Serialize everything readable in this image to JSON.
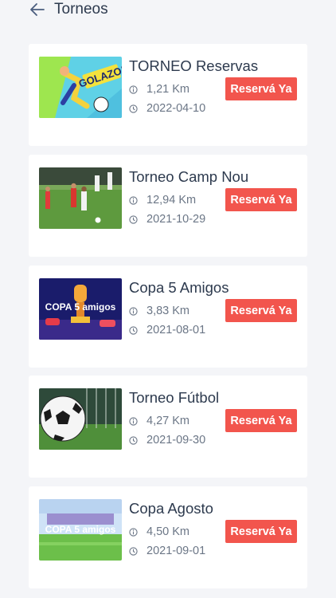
{
  "header": {
    "title": "Torneos",
    "back_icon": "arrow-left-icon"
  },
  "colors": {
    "accent": "#f2554d",
    "text_primary": "#2d3a4e",
    "text_secondary": "#6b7686",
    "background": "#f4f5f8",
    "card": "#ffffff"
  },
  "tournaments": [
    {
      "name": "TORNEO Reservas",
      "distance": "1,21 Km",
      "date": "2022-04-10",
      "button": "Reservá Ya",
      "image_text": "GOLAZO!"
    },
    {
      "name": "Torneo Camp Nou",
      "distance": "12,94 Km",
      "date": "2021-10-29",
      "button": "Reservá Ya",
      "image_text": ""
    },
    {
      "name": "Copa 5 Amigos",
      "distance": "3,83 Km",
      "date": "2021-08-01",
      "button": "Reservá Ya",
      "image_text": "COPA 5 amigos"
    },
    {
      "name": "Torneo Fútbol",
      "distance": "4,27 Km",
      "date": "2021-09-30",
      "button": "Reservá Ya",
      "image_text": ""
    },
    {
      "name": "Copa Agosto",
      "distance": "4,50 Km",
      "date": "2021-09-01",
      "button": "Reservá Ya",
      "image_text": "COPA 5 amigos"
    }
  ]
}
